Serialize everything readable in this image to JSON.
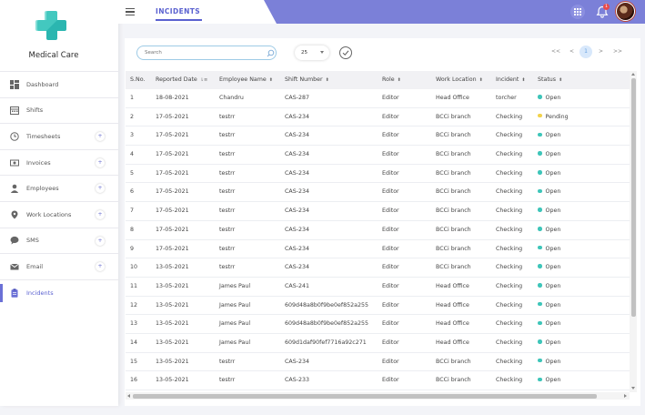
{
  "brand": {
    "name": "Medical Care",
    "primary": "#6b70d6",
    "logo_color": "#2bb6b0"
  },
  "header": {
    "title": "INCIDENTS",
    "notifications": "1"
  },
  "sidebar": {
    "items": [
      {
        "label": "Dashboard",
        "icon": "dashboard-icon",
        "expandable": false
      },
      {
        "label": "Shifts",
        "icon": "calendar-icon",
        "expandable": false
      },
      {
        "label": "Timesheets",
        "icon": "clock-icon",
        "expandable": true
      },
      {
        "label": "Invoices",
        "icon": "invoice-icon",
        "expandable": true
      },
      {
        "label": "Employees",
        "icon": "user-icon",
        "expandable": true
      },
      {
        "label": "Work Locations",
        "icon": "location-pin-icon",
        "expandable": true
      },
      {
        "label": "SMS",
        "icon": "chat-icon",
        "expandable": true
      },
      {
        "label": "Email",
        "icon": "mail-icon",
        "expandable": true
      },
      {
        "label": "Incidents",
        "icon": "clipboard-icon",
        "expandable": false,
        "active": true
      }
    ],
    "plus": "+"
  },
  "toolbar": {
    "search_placeholder": "Search",
    "page_size": "25",
    "pager": {
      "first": "<<",
      "prev": "<",
      "current": "1",
      "next": ">",
      "last": ">>"
    }
  },
  "table": {
    "columns": [
      "S.No.",
      "Reported Date",
      "Employee Name",
      "Shift Number",
      "Role",
      "Work Location",
      "Incident",
      "Status"
    ],
    "rows": [
      [
        "1",
        "18-08-2021",
        "Chandru",
        "CAS-287",
        "Editor",
        "Head Office",
        "torcher",
        "Open"
      ],
      [
        "2",
        "17-05-2021",
        "testrr",
        "CAS-234",
        "Editor",
        "BCCi branch",
        "Checking",
        "Pending"
      ],
      [
        "3",
        "17-05-2021",
        "testrr",
        "CAS-234",
        "Editor",
        "BCCi branch",
        "Checking",
        "Open"
      ],
      [
        "4",
        "17-05-2021",
        "testrr",
        "CAS-234",
        "Editor",
        "BCCi branch",
        "Checking",
        "Open"
      ],
      [
        "5",
        "17-05-2021",
        "testrr",
        "CAS-234",
        "Editor",
        "BCCi branch",
        "Checking",
        "Open"
      ],
      [
        "6",
        "17-05-2021",
        "testrr",
        "CAS-234",
        "Editor",
        "BCCi branch",
        "Checking",
        "Open"
      ],
      [
        "7",
        "17-05-2021",
        "testrr",
        "CAS-234",
        "Editor",
        "BCCi branch",
        "Checking",
        "Open"
      ],
      [
        "8",
        "17-05-2021",
        "testrr",
        "CAS-234",
        "Editor",
        "BCCi branch",
        "Checking",
        "Open"
      ],
      [
        "9",
        "17-05-2021",
        "testrr",
        "CAS-234",
        "Editor",
        "BCCi branch",
        "Checking",
        "Open"
      ],
      [
        "10",
        "13-05-2021",
        "testrr",
        "CAS-234",
        "Editor",
        "BCCi branch",
        "Checking",
        "Open"
      ],
      [
        "11",
        "13-05-2021",
        "James Paul",
        "CAS-241",
        "Editor",
        "Head Office",
        "Checking",
        "Open"
      ],
      [
        "12",
        "13-05-2021",
        "James Paul",
        "609d48a8b0f9be0ef852a255",
        "Editor",
        "Head Office",
        "Checking",
        "Open"
      ],
      [
        "13",
        "13-05-2021",
        "James Paul",
        "609d48a8b0f9be0ef852a255",
        "Editor",
        "Head Office",
        "Checking",
        "Open"
      ],
      [
        "14",
        "13-05-2021",
        "James Paul",
        "609d1daf90fef7716a92c271",
        "Editor",
        "Head Office",
        "Checking",
        "Open"
      ],
      [
        "15",
        "13-05-2021",
        "testrr",
        "CAS-234",
        "Editor",
        "BCCi branch",
        "Checking",
        "Open"
      ],
      [
        "16",
        "13-05-2021",
        "testrr",
        "CAS-233",
        "Editor",
        "BCCi branch",
        "Checking",
        "Open"
      ]
    ],
    "status_colors": {
      "Open": "#3ec5b9",
      "Pending": "#f2d24b"
    }
  }
}
